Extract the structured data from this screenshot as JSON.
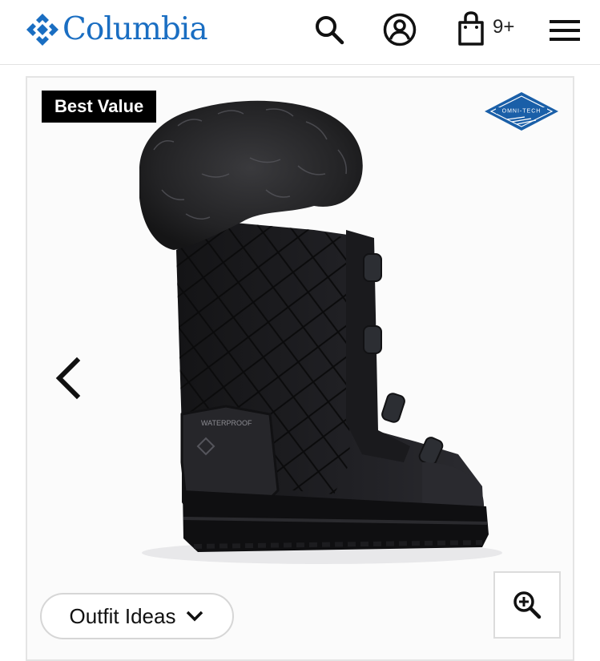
{
  "header": {
    "brand": "Columbia",
    "brand_color": "#1a6ec2",
    "icons": [
      "search-icon",
      "account-icon",
      "shopping-bag-icon",
      "hamburger-menu-icon"
    ],
    "bag_count": "9+"
  },
  "gallery": {
    "badge": "Best Value",
    "tech_badge_text": "OMNI-TECH",
    "tech_badge_color": "#1a5fa8",
    "product_marking": "WATERPROOF",
    "outfit_button_label": "Outfit Ideas",
    "icons": [
      "chevron-left-icon",
      "zoom-in-icon",
      "chevron-down-icon"
    ]
  }
}
